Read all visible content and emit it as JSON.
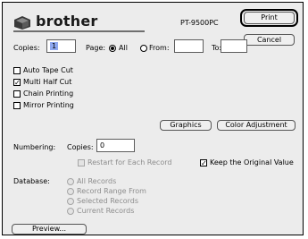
{
  "header": {
    "brand": "brother",
    "model": "PT-9500PC"
  },
  "buttons": {
    "print": "Print",
    "cancel": "Cancel",
    "graphics": "Graphics",
    "color_adjustment": "Color Adjustment",
    "preview": "Preview..."
  },
  "copies": {
    "label": "Copies:",
    "value": "1"
  },
  "page": {
    "label": "Page:",
    "all": "All",
    "from": "From:",
    "to": "To:",
    "from_value": "",
    "to_value": ""
  },
  "options": [
    {
      "label": "Auto Tape Cut",
      "checked": false
    },
    {
      "label": "Multi Half Cut",
      "checked": true
    },
    {
      "label": "Chain Printing",
      "checked": false
    },
    {
      "label": "Mirror Printing",
      "checked": false
    }
  ],
  "numbering": {
    "label": "Numbering:",
    "copies_label": "Copies:",
    "copies_value": "0",
    "restart_label": "Restart for Each Record",
    "keep_label": "Keep the Original Value",
    "keep_checked": true
  },
  "database": {
    "label": "Database:",
    "items": [
      "All Records",
      "Record Range From",
      "Selected Records",
      "Current Records"
    ]
  },
  "colors": {
    "selection": "#8ea8f0",
    "dialog_bg": "#ececec"
  }
}
